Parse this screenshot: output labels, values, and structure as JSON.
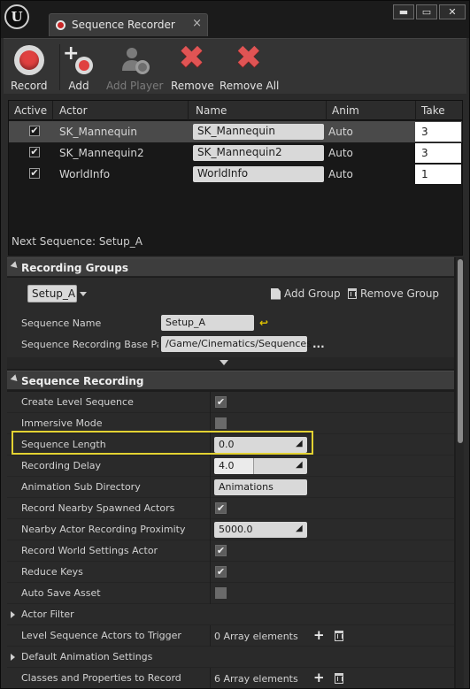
{
  "window": {
    "logo": "U",
    "tab_icon": "record-icon",
    "tab_title": "Sequence Recorder",
    "tab_close": "×",
    "min_glyph": "▬",
    "max_glyph": "▭",
    "close_glyph": "✕"
  },
  "toolbar": {
    "record": "Record",
    "add": "Add",
    "add_player": "Add Player",
    "remove": "Remove",
    "remove_all": "Remove All",
    "add_plus": "+",
    "remove_glyph": "✖"
  },
  "actor_table": {
    "columns": [
      "Active",
      "Actor",
      "Name",
      "Anim",
      "Take"
    ],
    "rows": [
      {
        "active": true,
        "check": "✔",
        "actor": "SK_Mannequin",
        "name": "SK_Mannequin",
        "anim": "Auto",
        "take": "3"
      },
      {
        "active": true,
        "check": "✔",
        "actor": "SK_Mannequin2",
        "name": "SK_Mannequin2",
        "anim": "Auto",
        "take": "3"
      },
      {
        "active": true,
        "check": "✔",
        "actor": "WorldInfo",
        "name": "WorldInfo",
        "anim": "Auto",
        "take": "1"
      }
    ],
    "next_sequence": "Next Sequence: Setup_A"
  },
  "recording_groups": {
    "header": "Recording Groups",
    "selected_group": "Setup_A",
    "add_group": "Add Group",
    "remove_group": "Remove Group",
    "sequence_name_label": "Sequence Name",
    "sequence_name_value": "Setup_A",
    "reset_glyph": "↩",
    "base_path_label": "Sequence Recording Base Path",
    "base_path_value": "/Game/Cinematics/Sequences",
    "browse_dots": "..."
  },
  "sequence_recording": {
    "header": "Sequence Recording",
    "check_glyph": "✔",
    "spin_glyph": "◢",
    "plus_glyph": "+",
    "properties": [
      {
        "label": "Create Level Sequence",
        "kind": "checkbox",
        "checked": true
      },
      {
        "label": "Immersive Mode",
        "kind": "checkbox",
        "checked": false
      },
      {
        "label": "Sequence Length",
        "kind": "number",
        "value": "0.0",
        "fill": 0
      },
      {
        "label": "Recording Delay",
        "kind": "number",
        "value": "4.0",
        "fill": 0.43
      },
      {
        "label": "Animation Sub Directory",
        "kind": "text",
        "value": "Animations"
      },
      {
        "label": "Record Nearby Spawned Actors",
        "kind": "checkbox",
        "checked": true
      },
      {
        "label": "Nearby Actor Recording Proximity",
        "kind": "number",
        "value": "5000.0",
        "fill": 0
      },
      {
        "label": "Record World Settings Actor",
        "kind": "checkbox",
        "checked": true
      },
      {
        "label": "Reduce Keys",
        "kind": "checkbox",
        "checked": true
      },
      {
        "label": "Auto Save Asset",
        "kind": "checkbox",
        "checked": false
      },
      {
        "label": "Actor Filter",
        "kind": "expander"
      },
      {
        "label": "Level Sequence Actors to Trigger",
        "kind": "array",
        "value": "0 Array elements"
      },
      {
        "label": "Default Animation Settings",
        "kind": "expander"
      },
      {
        "label": "Classes and Properties to Record",
        "kind": "array",
        "value": "6 Array elements"
      }
    ]
  },
  "colors": {
    "highlight": "#e3d232",
    "record_red": "#e0403f",
    "remove_red": "#e05454"
  }
}
